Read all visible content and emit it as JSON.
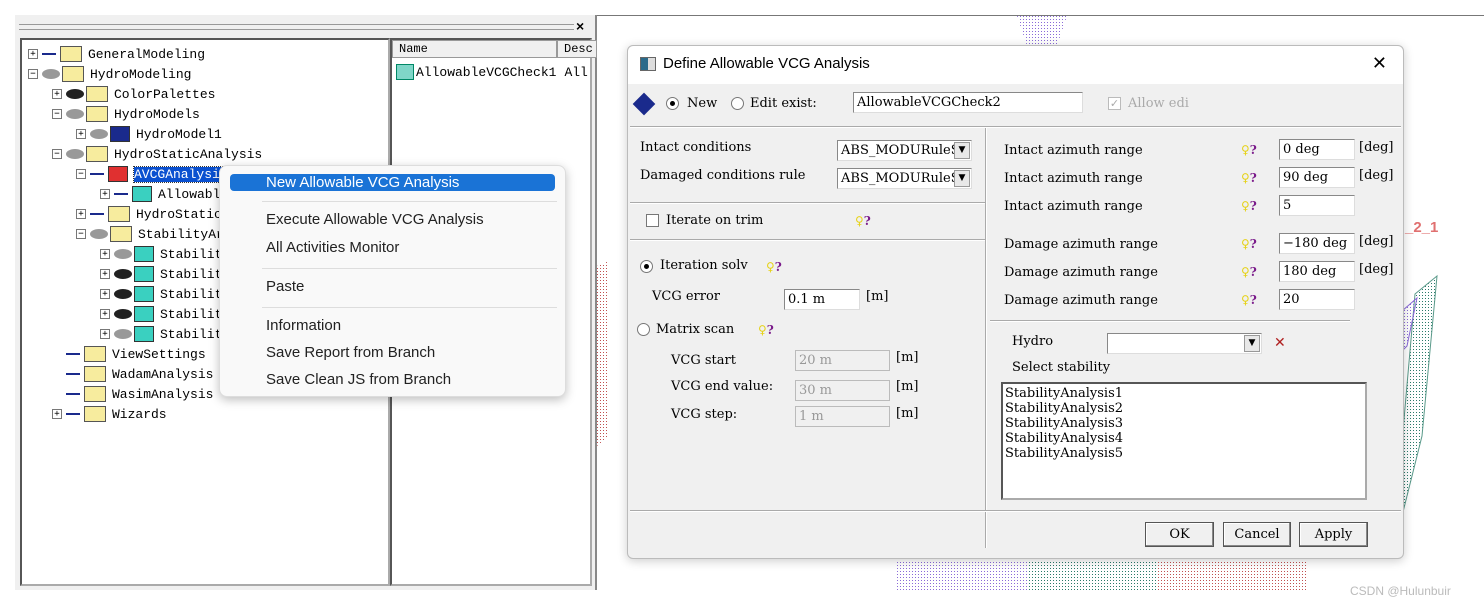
{
  "tree": {
    "items": [
      {
        "label": "GeneralModeling",
        "expander": "+"
      },
      {
        "label": "HydroModeling",
        "expander": "−"
      },
      {
        "label": "ColorPalettes",
        "expander": "+"
      },
      {
        "label": "HydroModels",
        "expander": "−"
      },
      {
        "label": "HydroModel1",
        "expander": "+"
      },
      {
        "label": "HydroStaticAnalysis",
        "expander": "−"
      },
      {
        "label": "AVCGAnalysis",
        "expander": "−"
      },
      {
        "label": "Allowabl",
        "expander": "+"
      },
      {
        "label": "HydroStatic",
        "expander": "+"
      },
      {
        "label": "StabilityAr",
        "expander": "−"
      },
      {
        "label": "Stabilit",
        "expander": "+"
      },
      {
        "label": "Stabilit",
        "expander": "+"
      },
      {
        "label": "Stabilit",
        "expander": "+"
      },
      {
        "label": "Stabilit",
        "expander": "+"
      },
      {
        "label": "Stabilit",
        "expander": "+"
      },
      {
        "label": "ViewSettings",
        "expander": ""
      },
      {
        "label": "WadamAnalysis",
        "expander": ""
      },
      {
        "label": "WasimAnalysis",
        "expander": ""
      },
      {
        "label": "Wizards",
        "expander": "+"
      }
    ]
  },
  "list": {
    "columns": [
      "Name",
      "Desc"
    ],
    "rows": [
      {
        "name": "AllowableVCGCheck1",
        "desc": "All"
      }
    ]
  },
  "panel": {
    "close": "×"
  },
  "context_menu": {
    "items": [
      "New Allowable VCG Analysis",
      "Execute Allowable VCG Analysis",
      "All Activities Monitor",
      "Paste",
      "Information",
      "Save Report from Branch",
      "Save Clean JS from Branch"
    ]
  },
  "dialog": {
    "title": "Define Allowable VCG Analysis",
    "close": "✕",
    "mode_new": "New",
    "mode_edit": "Edit exist:",
    "name_value": "AllowableVCGCheck2",
    "allow_edit": "Allow edi",
    "intact_conditions_label": "Intact conditions",
    "intact_conditions_value": "ABS_MODURuleSe",
    "damaged_conditions_label": "Damaged conditions rule",
    "damaged_conditions_value": "ABS_MODURuleSe",
    "iterate_on_trim": "Iterate on trim",
    "iteration_solver": "Iteration solv",
    "vcg_error_label": "VCG error",
    "vcg_error_value": "0.1 m",
    "unit_m": "[m]",
    "matrix_scan": "Matrix scan",
    "vcg_start_label": "VCG start",
    "vcg_start_value": "20 m",
    "vcg_end_label": "VCG end value:",
    "vcg_end_value": "30 m",
    "vcg_step_label": "VCG step:",
    "vcg_step_value": "1 m",
    "azimuth": [
      {
        "label": "Intact azimuth range",
        "value": "0 deg",
        "unit": "[deg]"
      },
      {
        "label": "Intact azimuth range",
        "value": "90 deg",
        "unit": "[deg]"
      },
      {
        "label": "Intact azimuth range",
        "value": "5",
        "unit": ""
      },
      {
        "label": "Damage azimuth range",
        "value": "−180 deg",
        "unit": "[deg]"
      },
      {
        "label": "Damage azimuth range",
        "value": "180 deg",
        "unit": "[deg]"
      },
      {
        "label": "Damage azimuth range",
        "value": "20",
        "unit": ""
      }
    ],
    "hydro_label": "Hydro",
    "hydro_value": "",
    "select_stability_label": "Select stability",
    "stability_list": [
      "StabilityAnalysis1",
      "StabilityAnalysis2",
      "StabilityAnalysis3",
      "StabilityAnalysis4",
      "StabilityAnalysis5"
    ],
    "ok": "OK",
    "cancel": "Cancel",
    "apply": "Apply"
  },
  "canvas": {
    "label": "_2_1"
  },
  "watermark": "CSDN @Hulunbuir",
  "colors": {
    "menu_highlight": "#1a73d6",
    "tree_selection": "#0a50d0",
    "help_bulb": "#e6d21a",
    "help_q": "#7a1a8a"
  }
}
